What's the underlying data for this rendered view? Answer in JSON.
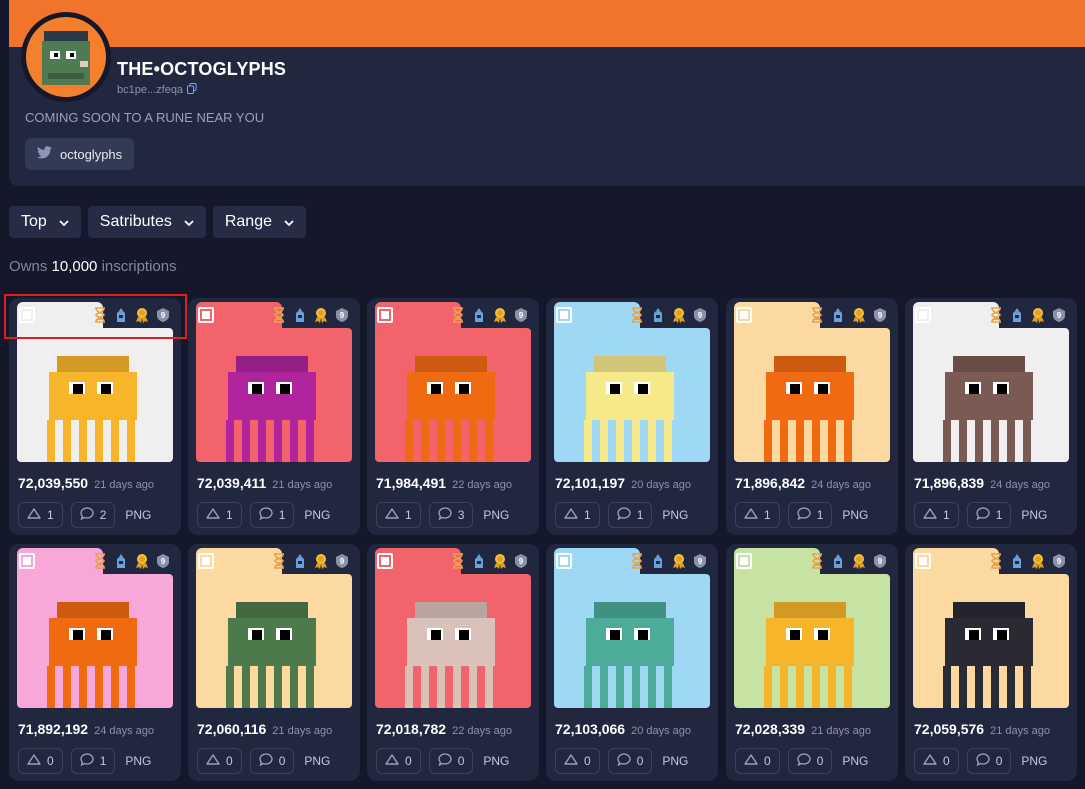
{
  "profile": {
    "name": "THE•OCTOGLYPHS",
    "address": "bc1pe...zfeqa",
    "tagline": "COMING SOON TO A RUNE NEAR YOU",
    "twitter_label": "octoglyphs"
  },
  "filters": [
    {
      "label": "Top"
    },
    {
      "label": "Satributes"
    },
    {
      "label": "Range"
    }
  ],
  "owns": {
    "prefix": "Owns",
    "count": "10,000",
    "suffix": "inscriptions"
  },
  "cards": [
    {
      "number": "72,039,550",
      "age": "21 days ago",
      "likes": "1",
      "comments": "2",
      "format": "PNG",
      "bg": "#f0eeee"
    },
    {
      "number": "72,039,411",
      "age": "21 days ago",
      "likes": "1",
      "comments": "1",
      "format": "PNG",
      "bg": "#f3636b"
    },
    {
      "number": "71,984,491",
      "age": "22 days ago",
      "likes": "1",
      "comments": "3",
      "format": "PNG",
      "bg": "#f3636b"
    },
    {
      "number": "72,101,197",
      "age": "20 days ago",
      "likes": "1",
      "comments": "1",
      "format": "PNG",
      "bg": "#9fd8f5"
    },
    {
      "number": "71,896,842",
      "age": "24 days ago",
      "likes": "1",
      "comments": "1",
      "format": "PNG",
      "bg": "#fbd9a0"
    },
    {
      "number": "71,896,839",
      "age": "24 days ago",
      "likes": "1",
      "comments": "1",
      "format": "PNG",
      "bg": "#f0eeee"
    },
    {
      "number": "71,892,192",
      "age": "24 days ago",
      "likes": "0",
      "comments": "1",
      "format": "PNG",
      "bg": "#f7a8d8"
    },
    {
      "number": "72,060,116",
      "age": "21 days ago",
      "likes": "0",
      "comments": "0",
      "format": "PNG",
      "bg": "#fbd9a0"
    },
    {
      "number": "72,018,782",
      "age": "22 days ago",
      "likes": "0",
      "comments": "0",
      "format": "PNG",
      "bg": "#f3636b"
    },
    {
      "number": "72,103,066",
      "age": "20 days ago",
      "likes": "0",
      "comments": "0",
      "format": "PNG",
      "bg": "#9fd8f5"
    },
    {
      "number": "72,028,339",
      "age": "21 days ago",
      "likes": "0",
      "comments": "0",
      "format": "PNG",
      "bg": "#c7e3a3"
    },
    {
      "number": "72,059,576",
      "age": "21 days ago",
      "likes": "0",
      "comments": "0",
      "format": "PNG",
      "bg": "#fbd9a0"
    }
  ],
  "colors": {
    "banner": "#f2742a",
    "background": "#15182a",
    "panel": "#222740",
    "highlight": "#e01f1f"
  }
}
